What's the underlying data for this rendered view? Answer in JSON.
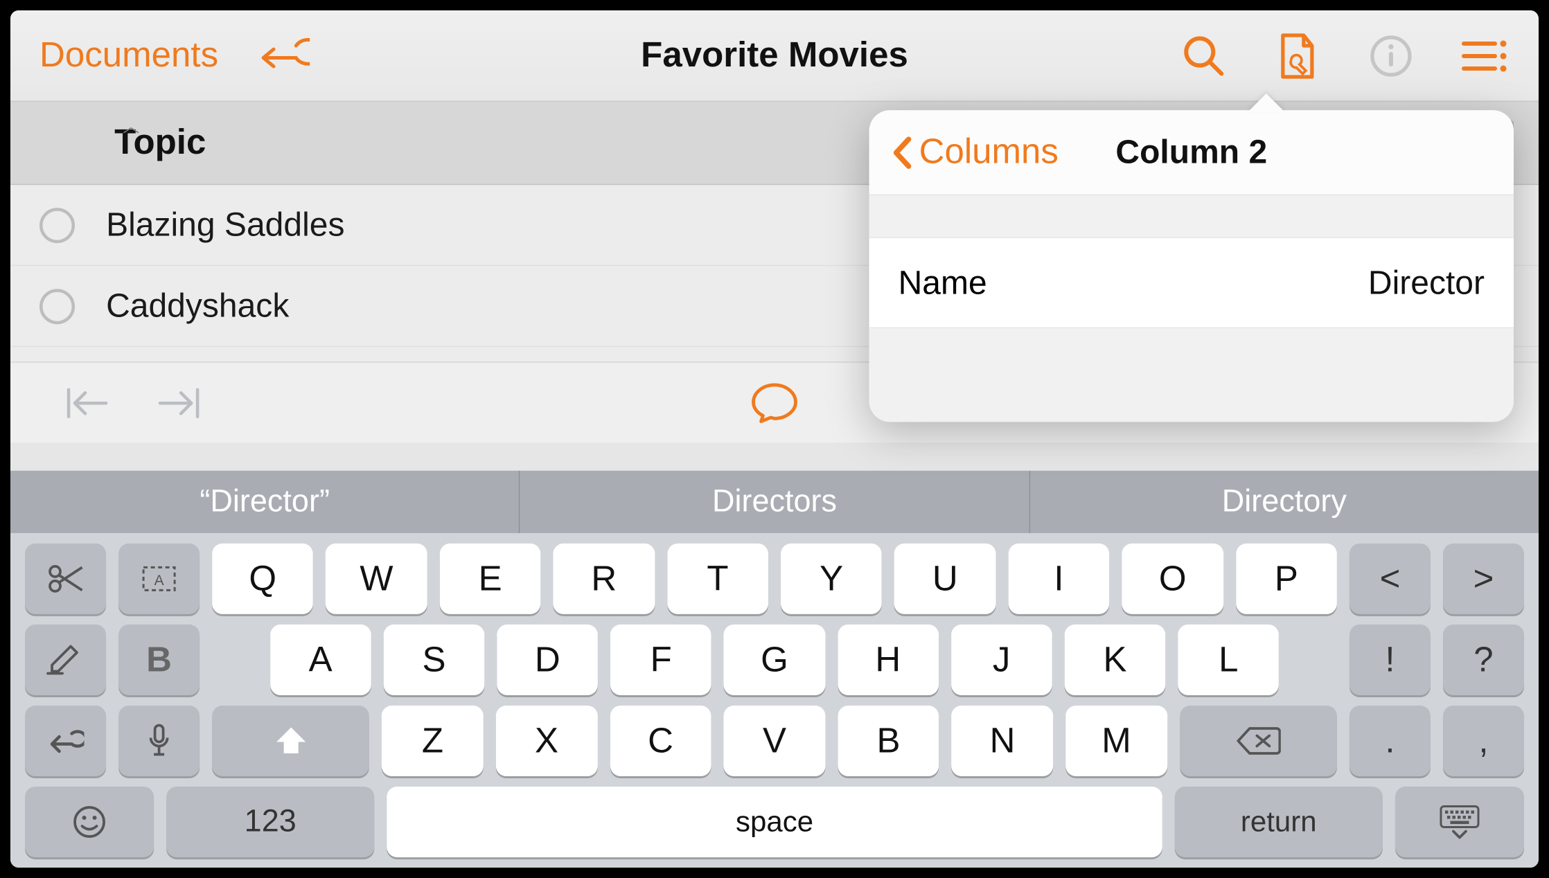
{
  "toolbar": {
    "documents_label": "Documents",
    "title": "Favorite Movies"
  },
  "column_header": {
    "label": "Topic"
  },
  "rows": [
    {
      "text": "Blazing Saddles"
    },
    {
      "text": "Caddyshack"
    }
  ],
  "popover": {
    "back_label": "Columns",
    "title": "Column 2",
    "field_label": "Name",
    "field_value": "Director"
  },
  "predictive": [
    "“Director”",
    "Directors",
    "Directory"
  ],
  "keyboard": {
    "row1": [
      "Q",
      "W",
      "E",
      "R",
      "T",
      "Y",
      "U",
      "I",
      "O",
      "P"
    ],
    "row2": [
      "A",
      "S",
      "D",
      "F",
      "G",
      "H",
      "J",
      "K",
      "L"
    ],
    "row3": [
      "Z",
      "X",
      "C",
      "V",
      "B",
      "N",
      "M"
    ],
    "row1_right": [
      "<",
      ">"
    ],
    "row2_right": [
      "!",
      "?"
    ],
    "row3_right": [
      ".",
      ","
    ],
    "numbers_label": "123",
    "space_label": "space",
    "return_label": "return",
    "bold_label": "B"
  }
}
